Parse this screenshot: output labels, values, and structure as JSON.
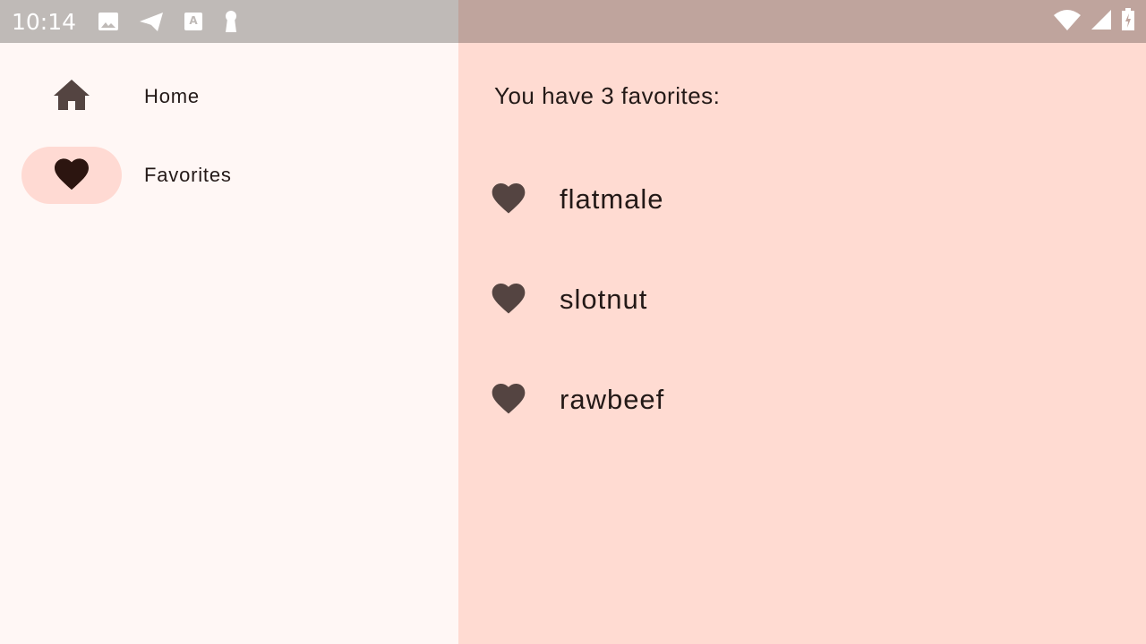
{
  "status_bar": {
    "time": "10:14",
    "left_icons": [
      "image-icon",
      "telegram-icon",
      "keyboard-a-icon",
      "keyhole-icon"
    ],
    "right_icons": [
      "wifi-icon",
      "signal-icon",
      "battery-charging-icon"
    ],
    "left_bg": "#bfbab7",
    "right_bg": "#bfa49d"
  },
  "nav": {
    "items": [
      {
        "label": "Home",
        "icon": "home-icon",
        "selected": false
      },
      {
        "label": "Favorites",
        "icon": "heart-icon",
        "selected": true
      }
    ]
  },
  "main": {
    "header": "You have 3 favorites:",
    "favorites": [
      {
        "name": "flatmale",
        "icon": "heart-icon"
      },
      {
        "name": "slotnut",
        "icon": "heart-icon"
      },
      {
        "name": "rawbeef",
        "icon": "heart-icon"
      }
    ]
  },
  "colors": {
    "accent": "#ffdad3",
    "icon": "#544441",
    "selected_icon": "#2c1510",
    "panel_bg": "#ffdbd2",
    "rail_bg": "#fff7f5"
  }
}
